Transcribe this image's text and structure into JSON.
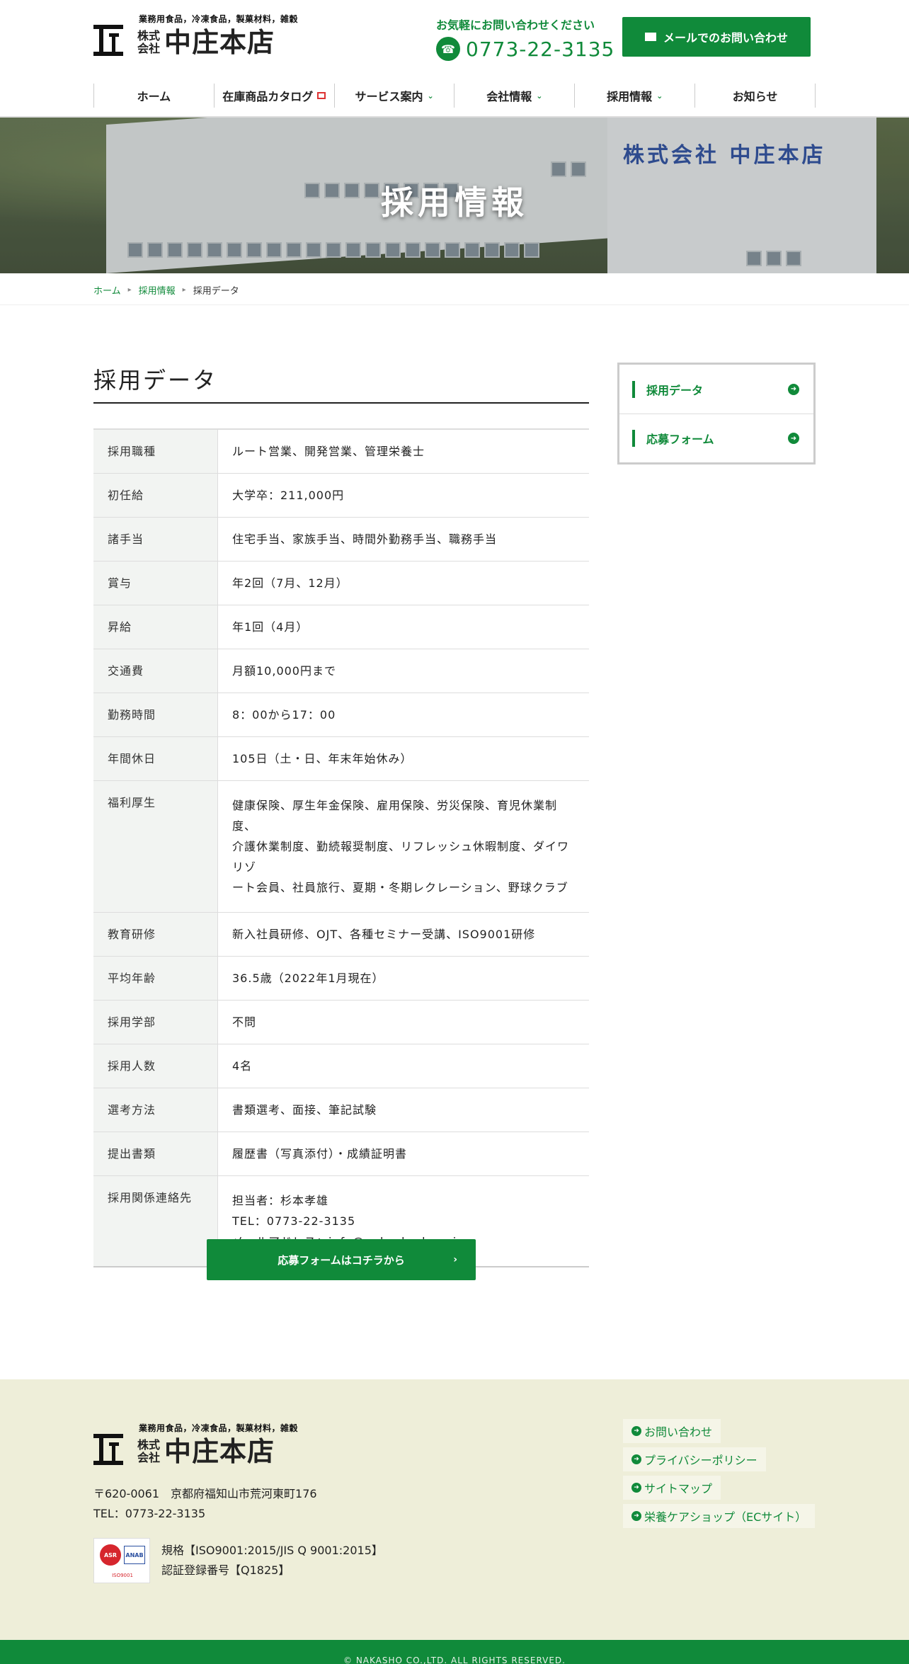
{
  "header": {
    "logo_sub": "業務用食品，冷凍食品，製菓材料，雑穀",
    "logo_kk_top": "株式",
    "logo_kk_bottom": "会社",
    "logo_name": "中庄本店",
    "contact_label": "お気軽にお問い合わせください",
    "phone": "0773-22-3135",
    "mail_button": "メールでのお問い合わせ"
  },
  "nav": {
    "items": [
      {
        "label": "ホーム"
      },
      {
        "label": "在庫商品カタログ"
      },
      {
        "label": "サービス案内"
      },
      {
        "label": "会社情報"
      },
      {
        "label": "採用情報"
      },
      {
        "label": "お知らせ"
      }
    ]
  },
  "hero": {
    "title": "採用情報",
    "sign": "株式会社 中庄本店"
  },
  "breadcrumb": {
    "home": "ホーム",
    "parent": "採用情報",
    "current": "採用データ"
  },
  "main": {
    "title": "採用データ",
    "rows": [
      {
        "label": "採用職種",
        "value": "ルート営業、開発営業、管理栄養士"
      },
      {
        "label": "初任給",
        "value": "大学卒：211,000円"
      },
      {
        "label": "諸手当",
        "value": "住宅手当、家族手当、時間外勤務手当、職務手当"
      },
      {
        "label": "賞与",
        "value": "年2回（7月、12月）"
      },
      {
        "label": "昇給",
        "value": "年1回（4月）"
      },
      {
        "label": "交通費",
        "value": "月額10,000円まで"
      },
      {
        "label": "勤務時間",
        "value": "8：00から17：00"
      },
      {
        "label": "年間休日",
        "value": "105日（土・日、年末年始休み）"
      },
      {
        "label": "福利厚生",
        "value_lines": [
          "健康保険、厚生年金保険、雇用保険、労災保険、育児休業制度、",
          "介護休業制度、勤続報奨制度、リフレッシュ休暇制度、ダイワリゾ",
          "ート会員、社員旅行、夏期・冬期レクレーション、野球クラブ"
        ]
      },
      {
        "label": "教育研修",
        "value": "新入社員研修、OJT、各種セミナー受講、ISO9001研修"
      },
      {
        "label": "平均年齢",
        "value": "36.5歳（2022年1月現在）"
      },
      {
        "label": "採用学部",
        "value": "不問"
      },
      {
        "label": "採用人数",
        "value": "4名"
      },
      {
        "label": "選考方法",
        "value": "書類選考、面接、筆記試験"
      },
      {
        "label": "提出書類",
        "value": "履歴書（写真添付）・成績証明書"
      },
      {
        "label": "採用関係連絡先",
        "value_lines": [
          "担当者：杉本孝雄",
          "TEL：0773-22-3135",
          "メールアドレス：info@nakasho-h.co.jp"
        ]
      }
    ],
    "apply_button": "応募フォームはコチラから",
    "apply_arrow": "›"
  },
  "sidebar": {
    "items": [
      {
        "label": "採用データ"
      },
      {
        "label": "応募フォーム"
      }
    ]
  },
  "footer": {
    "logo_sub": "業務用食品，冷凍食品，製菓材料，雑穀",
    "logo_kk_top": "株式",
    "logo_kk_bottom": "会社",
    "logo_name": "中庄本店",
    "address": "〒620-0061　京都府福知山市荒河東町176",
    "tel": "TEL：0773-22-3135",
    "iso_badge_left": "ASR",
    "iso_badge_right": "ANAB",
    "iso_caption": "ISO9001",
    "iso_standard": "規格【ISO9001:2015/JIS Q 9001:2015】",
    "iso_reg": "認証登録番号【Q1825】",
    "links": [
      {
        "label": "お問い合わせ"
      },
      {
        "label": "プライバシーポリシー"
      },
      {
        "label": "サイトマップ"
      },
      {
        "label": "栄養ケアショップ（ECサイト）"
      }
    ],
    "copyright": "© NAKASHO CO.,LTD. ALL RIGHTS RESERVED."
  },
  "colors": {
    "brand_green": "#108a3a",
    "footer_bg": "#eeeed9"
  }
}
